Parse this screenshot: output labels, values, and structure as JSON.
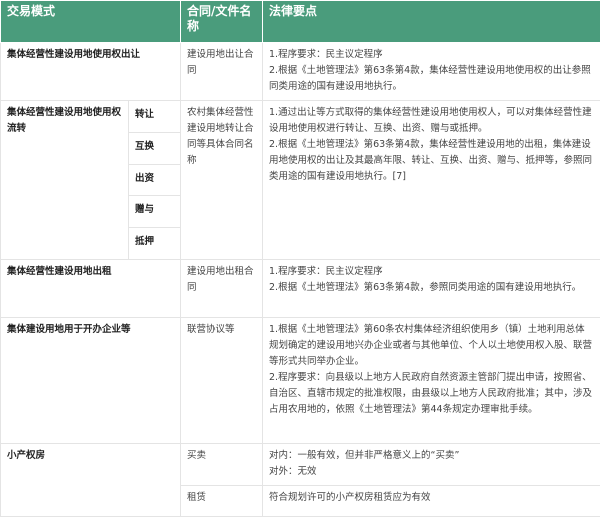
{
  "headers": {
    "mode": "交易模式",
    "contract": "合同/文件名称",
    "points": "法律要点"
  },
  "row_outright": {
    "mode": "集体经营性建设用地使用权出让",
    "contract": "建设用地出让合同",
    "points": [
      "1.程序要求：民主议定程序",
      "2.根据《土地管理法》第63条第4款，集体经营性建设用地使用权的出让参照同类用途的国有建设用地执行。"
    ]
  },
  "row_transfer": {
    "mode": "集体经营性建设用地使用权流转",
    "sub_modes": [
      "转让",
      "互换",
      "出资",
      "赠与",
      "抵押"
    ],
    "contract": "农村集体经营性建设用地转让合同等具体合同名称",
    "points": [
      "1.通过出让等方式取得的集体经营性建设用地使用权人，可以对集体经营性建设用地使用权进行转让、互换、出资、赠与或抵押。",
      "2.根据《土地管理法》第63条第4款，集体经营性建设用地的出租，集体建设用地使用权的出让及其最高年限、转让、互换、出资、赠与、抵押等，参照同类用途的国有建设用地执行。[7]"
    ]
  },
  "row_lease": {
    "mode": "集体经营性建设用地出租",
    "contract": "建设用地出租合同",
    "points": [
      "1.程序要求：民主议定程序",
      "2.根据《土地管理法》第63条第4款，参照同类用途的国有建设用地执行。"
    ]
  },
  "row_enterprise": {
    "mode": "集体建设用地用于开办企业等",
    "contract": "联营协议等",
    "points": [
      "1.根据《土地管理法》第60条农村集体经济组织使用乡（镇）土地利用总体规划确定的建设用地兴办企业或者与其他单位、个人以土地使用权入股、联营等形式共同举办企业。",
      "2.程序要求：向县级以上地方人民政府自然资源主管部门提出申请，按照省、自治区、直辖市规定的批准权限，由县级以上地方人民政府批准；其中，涉及占用农用地的，依照《土地管理法》第44条规定办理审批手续。"
    ]
  },
  "row_small_property": {
    "mode": "小产权房",
    "sale": {
      "contract": "买卖",
      "points": [
        "对内：一般有效，但并非严格意义上的“买卖”",
        "对外：无效"
      ]
    },
    "rent": {
      "contract": "租赁",
      "points": [
        "符合规划许可的小产权房租赁应为有效"
      ]
    }
  }
}
